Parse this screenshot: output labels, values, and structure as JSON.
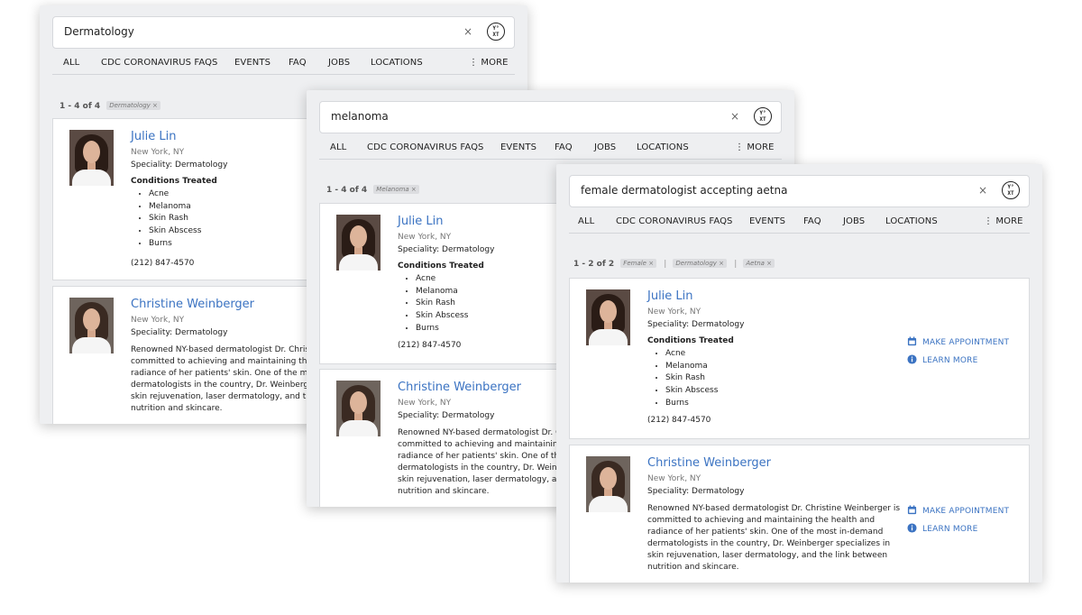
{
  "tabs": [
    "ALL",
    "CDC CORONAVIRUS FAQS",
    "EVENTS",
    "FAQ",
    "JOBS",
    "LOCATIONS",
    "⋮ MORE"
  ],
  "icons": {
    "clear": "×",
    "logo": "yext-logo-icon"
  },
  "colors": {
    "link": "#3b73c2",
    "panel": "#eeeff1"
  },
  "windows": [
    {
      "query": "Dermatology",
      "result_count": "1 - 4 of 4",
      "filters": [
        "Dermatology ×"
      ],
      "results": [
        {
          "name": "Julie Lin",
          "location": "New York, NY",
          "speciality": "Speciality: Dermatology",
          "conditions_title": "Conditions Treated",
          "conditions": [
            "Acne",
            "Melanoma",
            "Skin Rash",
            "Skin Abscess",
            "Burns"
          ],
          "phone": "(212) 847-4570"
        },
        {
          "name": "Christine Weinberger",
          "location": "New York, NY",
          "speciality": "Speciality: Dermatology",
          "description": "Renowned NY-based dermatologist Dr. Christine Weinberger is committed to achieving and maintaining the health and radiance of her patients' skin. One of the most in-demand dermatologists in the country, Dr. Weinberger specializes in skin rejuvenation, laser dermatology, and the link between nutrition and skincare."
        }
      ]
    },
    {
      "query": "melanoma",
      "result_count": "1 - 4 of 4",
      "filters": [
        "Melanoma ×"
      ],
      "results": [
        {
          "name": "Julie Lin",
          "location": "New York, NY",
          "speciality": "Speciality: Dermatology",
          "conditions_title": "Conditions Treated",
          "conditions": [
            "Acne",
            "Melanoma",
            "Skin Rash",
            "Skin Abscess",
            "Burns"
          ],
          "phone": "(212) 847-4570"
        },
        {
          "name": "Christine Weinberger",
          "location": "New York, NY",
          "speciality": "Speciality: Dermatology",
          "description": "Renowned NY-based dermatologist Dr. Christine Weinberger is committed to achieving and maintaining the health and radiance of her patients' skin. One of the most in-demand dermatologists in the country, Dr. Weinberger specializes in skin rejuvenation, laser dermatology, and the link between nutrition and skincare."
        }
      ]
    },
    {
      "query": "female dermatologist accepting aetna",
      "result_count": "1 - 2 of 2",
      "filters": [
        "Female ×",
        "Dermatology ×",
        "Aetna ×"
      ],
      "filter_separator": "|",
      "results": [
        {
          "name": "Julie Lin",
          "location": "New York, NY",
          "speciality": "Speciality: Dermatology",
          "conditions_title": "Conditions Treated",
          "conditions": [
            "Acne",
            "Melanoma",
            "Skin Rash",
            "Skin Abscess",
            "Burns"
          ],
          "phone": "(212) 847-4570",
          "cta_primary": "MAKE APPOINTMENT",
          "cta_secondary": "LEARN MORE"
        },
        {
          "name": "Christine Weinberger",
          "location": "New York, NY",
          "speciality": "Speciality: Dermatology",
          "description": "Renowned NY-based dermatologist Dr. Christine Weinberger is committed to achieving and maintaining the health and radiance of her patients' skin. One of the most in-demand dermatologists in the country, Dr. Weinberger specializes in skin rejuvenation, laser dermatology, and the link between nutrition and skincare.",
          "cta_primary": "MAKE APPOINTMENT",
          "cta_secondary": "LEARN MORE"
        }
      ]
    }
  ]
}
